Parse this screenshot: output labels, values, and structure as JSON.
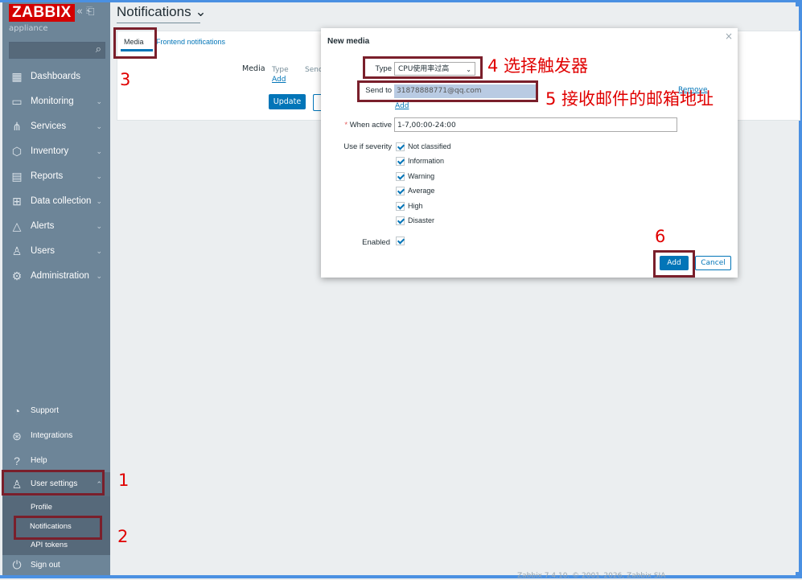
{
  "app": {
    "logo": "ZABBIX",
    "logo_icons": "« ⎗",
    "server_name": "appliance"
  },
  "sidebar": {
    "items": [
      {
        "label": "Dashboards",
        "chevron": ""
      },
      {
        "label": "Monitoring",
        "chevron": "⌄"
      },
      {
        "label": "Services",
        "chevron": "⌄"
      },
      {
        "label": "Inventory",
        "chevron": "⌄"
      },
      {
        "label": "Reports",
        "chevron": "⌄"
      },
      {
        "label": "Data collection",
        "chevron": "⌄"
      },
      {
        "label": "Alerts",
        "chevron": "⌄"
      },
      {
        "label": "Users",
        "chevron": "⌄"
      },
      {
        "label": "Administration",
        "chevron": "⌄"
      }
    ],
    "bottom": [
      {
        "label": "Support"
      },
      {
        "label": "Integrations"
      },
      {
        "label": "Help"
      },
      {
        "label": "User settings",
        "chevron": "⌃"
      }
    ],
    "submenu": [
      "Profile",
      "Notifications",
      "API tokens"
    ],
    "signout": "Sign out"
  },
  "header": {
    "title": "Notifications ⌄"
  },
  "tabs": [
    {
      "label": "Media"
    },
    {
      "label": "Frontend notifications"
    }
  ],
  "media_section": {
    "label": "Media",
    "col_type": "Type",
    "col_send": "Senc",
    "add": "Add",
    "update": "Update"
  },
  "modal": {
    "title": "New media",
    "close": "×",
    "type_label": "Type",
    "type_value": "CPU使用率过高",
    "sendto_label": "Send to",
    "sendto_value": "31878888771@qq.com",
    "remove": "Remove",
    "add_link": "Add",
    "when_active_label": "When active",
    "when_active_value": "1-7,00:00-24:00",
    "severity_label": "Use if severity",
    "severities": [
      "Not classified",
      "Information",
      "Warning",
      "Average",
      "High",
      "Disaster"
    ],
    "enabled_label": "Enabled",
    "add_button": "Add",
    "cancel_button": "Cancel"
  },
  "footer": "Zabbix 7.4.10. © 2001–2026, Zabbix SIA",
  "annotations": {
    "n1": "1",
    "n2": "2",
    "n3": "3",
    "n4": "4 选择触发器",
    "n5": "5 接收邮件的邮箱地址",
    "n6": "6"
  },
  "colors": {
    "accent": "#0275b8",
    "sidebar": "#6d8598",
    "logo": "#d40000",
    "annotation": "#e00000",
    "annotation_box": "#7a1f2b"
  }
}
